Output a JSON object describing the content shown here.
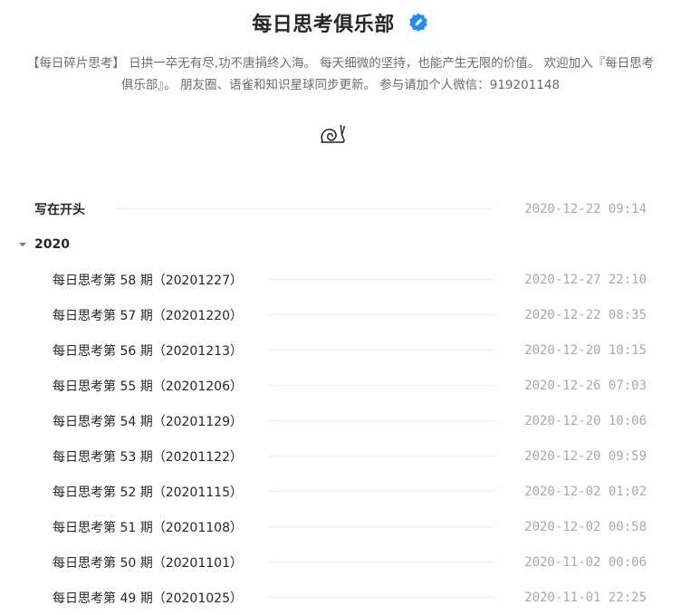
{
  "header": {
    "title": "每日思考俱乐部",
    "description": "【每日碎片思考】 日拱一卒无有尽,功不唐捐终入海。 每天细微的坚持，也能产生无限的价值。 欢迎加入『每日思考俱乐部』。 朋友圈、语雀和知识星球同步更新。 参与请加个人微信：919201148",
    "verified_icon": "verified-pen-badge-icon",
    "mascot_icon": "snail-icon",
    "accent_color": "#1f8cff"
  },
  "toc": {
    "intro": {
      "label": "写在开头",
      "time": "2020-12-22 09:14"
    },
    "group": {
      "label": "2020",
      "expanded": true,
      "items": [
        {
          "label": "每日思考第 58 期（20201227）",
          "time": "2020-12-27 22:10"
        },
        {
          "label": "每日思考第 57 期（20201220）",
          "time": "2020-12-22 08:35"
        },
        {
          "label": "每日思考第 56 期（20201213）",
          "time": "2020-12-20 10:15"
        },
        {
          "label": "每日思考第 55 期（20201206）",
          "time": "2020-12-26 07:03"
        },
        {
          "label": "每日思考第 54 期（20201129）",
          "time": "2020-12-20 10:06"
        },
        {
          "label": "每日思考第 53 期（20201122）",
          "time": "2020-12-20 09:59"
        },
        {
          "label": "每日思考第 52 期（20201115）",
          "time": "2020-12-02 01:02"
        },
        {
          "label": "每日思考第 51 期（20201108）",
          "time": "2020-12-02 00:58"
        },
        {
          "label": "每日思考第 50 期（20201101）",
          "time": "2020-11-02 00:06"
        },
        {
          "label": "每日思考第 49 期（20201025）",
          "time": "2020-11-01 22:25"
        }
      ]
    }
  }
}
